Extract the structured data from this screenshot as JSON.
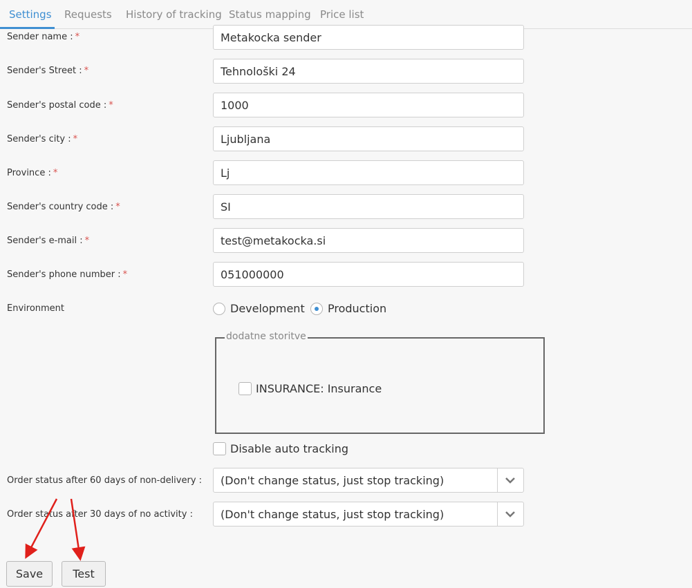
{
  "tabs": [
    {
      "label": "Settings",
      "active": true
    },
    {
      "label": "Requests"
    },
    {
      "label": "History of tracking"
    },
    {
      "label": "Status mapping"
    },
    {
      "label": "Price list"
    }
  ],
  "fields": [
    {
      "label": "Sender name :",
      "value": "Metakocka sender"
    },
    {
      "label": "Sender's Street :",
      "value": "Tehnološki 24"
    },
    {
      "label": "Sender's postal code :",
      "value": "1000"
    },
    {
      "label": "Sender's city :",
      "value": "Ljubljana"
    },
    {
      "label": "Province :",
      "value": "Lj"
    },
    {
      "label": "Sender's country code :",
      "value": "SI"
    },
    {
      "label": "Sender's e-mail :",
      "value": "test@metakocka.si"
    },
    {
      "label": "Sender's phone number :",
      "value": "051000000"
    }
  ],
  "required_mark": "*",
  "environment": {
    "label": "Environment",
    "options": [
      "Development",
      "Production"
    ],
    "selected": "Production"
  },
  "additional_services": {
    "legend": "dodatne storitve",
    "insurance_label": "INSURANCE: Insurance",
    "insurance_checked": false
  },
  "disable_auto_tracking": {
    "label": "Disable auto tracking",
    "checked": false
  },
  "status_60": {
    "label": "Order status after 60 days of non-delivery :",
    "value": "(Don't change status, just stop tracking)"
  },
  "status_30": {
    "label": "Order status after 30 days of no activity :",
    "value": "(Don't change status, just stop tracking)"
  },
  "buttons": {
    "save": "Save",
    "test": "Test"
  },
  "colors": {
    "accent": "#3f8fd2",
    "required": "#d9534f",
    "annotation_arrow": "#e0201b"
  }
}
